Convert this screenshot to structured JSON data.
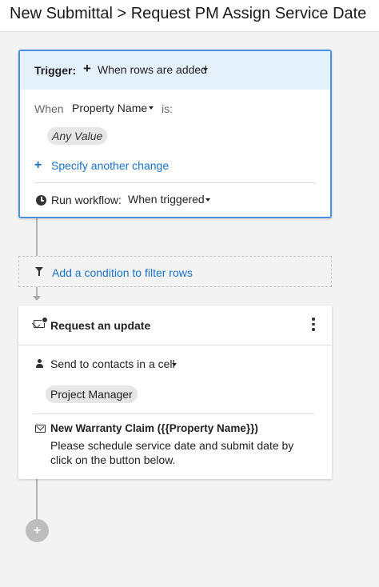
{
  "header": {
    "title": "New Submittal > Request PM Assign Service Date"
  },
  "trigger": {
    "label": "Trigger:",
    "add_icon": "plus-icon",
    "value": "When rows are added",
    "when_label": "When",
    "field": "Property Name",
    "is_label": "is:",
    "value_chip": "Any Value",
    "specify_icon": "plus-icon",
    "specify_link": "Specify another change",
    "run_icon": "clock-icon",
    "run_label": "Run workflow:",
    "run_value": "When triggered"
  },
  "condition": {
    "icon": "filter-icon",
    "label": "Add a condition to filter rows"
  },
  "action": {
    "icon": "request-update-icon",
    "title": "Request an update",
    "menu_icon": "kebab-menu-icon",
    "send_icon": "person-icon",
    "send_label": "Send to contacts in a cell",
    "contact_chip": "Project Manager",
    "message_icon": "mail-icon",
    "message_subject": "New Warranty Claim ({{Property Name}})",
    "message_body": "Please schedule service date and submit date by click on the button below."
  },
  "add_step": {
    "icon": "plus-icon",
    "label": "+"
  },
  "colors": {
    "accent": "#1a73c9",
    "trigger_border": "#4a90e2",
    "trigger_header_bg": "#e4f1fb",
    "background": "#f3f3f3"
  }
}
